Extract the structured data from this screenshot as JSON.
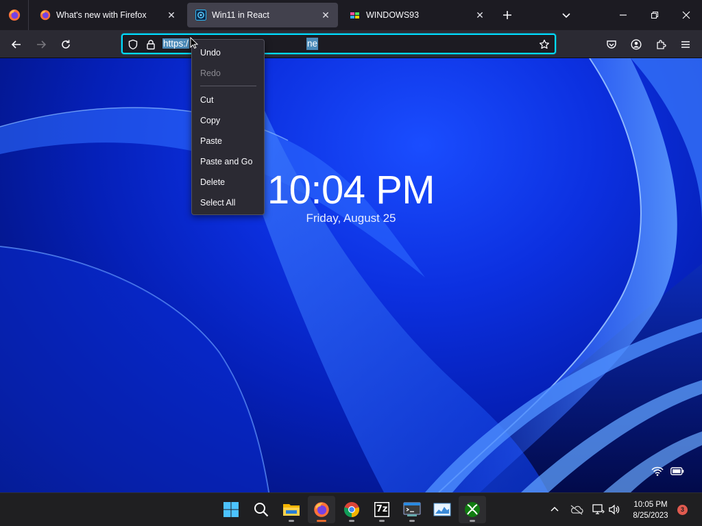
{
  "colors": {
    "accent": "#00ddff",
    "tab_active": "#42414d",
    "menu_bg": "#2b2a33",
    "taskbar_bg": "#1f1f21",
    "notification": "#e05a4f"
  },
  "tabs": [
    {
      "title": "What's new with Firefox",
      "icon": "firefox-icon",
      "active": false
    },
    {
      "title": "Win11 in React",
      "icon": "win11-react-icon",
      "active": true
    },
    {
      "title": "WINDOWS93",
      "icon": "windows93-icon",
      "active": false
    }
  ],
  "urlbar": {
    "text_start": "https:/",
    "text_end": "ne"
  },
  "context_menu": {
    "items": [
      {
        "label": "Undo",
        "enabled": true
      },
      {
        "label": "Redo",
        "enabled": false
      },
      {
        "label": "Cut",
        "enabled": true
      },
      {
        "label": "Copy",
        "enabled": true
      },
      {
        "label": "Paste",
        "enabled": true
      },
      {
        "label": "Paste and Go",
        "enabled": true
      },
      {
        "label": "Delete",
        "enabled": true
      },
      {
        "label": "Select All",
        "enabled": true
      }
    ]
  },
  "lockscreen": {
    "time": "10:04 PM",
    "date": "Friday, August 25"
  },
  "taskbar": {
    "apps": [
      {
        "icon": "windows-start-icon"
      },
      {
        "icon": "search-icon"
      },
      {
        "icon": "file-explorer-icon"
      },
      {
        "icon": "firefox-icon"
      },
      {
        "icon": "chrome-icon"
      },
      {
        "icon": "7zip-icon",
        "label": "7z"
      },
      {
        "icon": "terminal-icon"
      },
      {
        "icon": "task-manager-icon"
      },
      {
        "icon": "xbox-icon"
      }
    ],
    "clock_time": "10:05 PM",
    "clock_date": "8/25/2023",
    "notification_count": "3"
  }
}
